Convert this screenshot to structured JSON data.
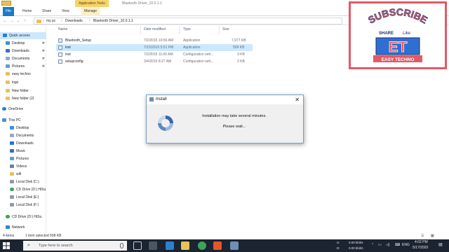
{
  "window": {
    "title": "Bluetooth Driver_10.0.1.1",
    "contextual_tab": "Application Tools"
  },
  "ribbon": {
    "tabs": [
      {
        "label": "File"
      },
      {
        "label": "Home"
      },
      {
        "label": "Share"
      },
      {
        "label": "View"
      },
      {
        "label": "Manage"
      }
    ]
  },
  "address": {
    "crumbs": [
      "my pc",
      "Downloads",
      "Bluetooth Driver_10.0.1.1"
    ]
  },
  "nav": {
    "quick_access": "Quick access",
    "pinned": [
      "Desktop",
      "Downloads",
      "Documents",
      "Pictures"
    ],
    "folders": [
      "easy techno",
      "logo",
      "New folder",
      "New folder (2)"
    ],
    "onedrive": "OneDrive",
    "this_pc": "This PC",
    "pc_items": [
      "Desktop",
      "Documents",
      "Downloads",
      "Music",
      "Pictures",
      "Videos",
      "wifi",
      "Local Disk (C:)",
      "CD Drive (D:) HiSu",
      "Local Disk (E:)",
      "Local Disk (F:)"
    ],
    "cd_drive": "CD Drive (D:) HiSu",
    "network": "Network"
  },
  "columns": {
    "name": "Name",
    "date": "Date modified",
    "type": "Type",
    "size": "Size"
  },
  "files": [
    {
      "name": "Bluetooth_Setup",
      "date": "7/2/2015 10:56 AM",
      "type": "Application",
      "size": "7,977 KB"
    },
    {
      "name": "inst",
      "date": "7/15/2015 5:51 PM",
      "type": "Application",
      "size": "509 KB"
    },
    {
      "name": "inst",
      "date": "7/2/2015 11:00 AM",
      "type": "Configuration sett...",
      "size": "3 KB"
    },
    {
      "name": "setupconfig",
      "date": "3/4/2015 8:27 AM",
      "type": "Configuration sett...",
      "size": "2 KB"
    }
  ],
  "status": {
    "items": "4 items",
    "selection": "1 item selected  508 KB"
  },
  "dialog": {
    "title": "Install",
    "message1": "Installation may take several minutes.",
    "message2": "Please wait...",
    "close": "✕"
  },
  "subscribe": {
    "word": "SUBSCRIBE",
    "share": "SHARE",
    "like": "Like",
    "logo": "ET",
    "brand": "EASY TECHNO"
  },
  "taskbar": {
    "search": "Type here to search",
    "net_up": "0.00 kbit/s",
    "net_down": "0.00 kbit/s",
    "lang": "ENG",
    "time": "4:02 PM",
    "date": "5/17/2020",
    "u": "U:",
    "d": "D:"
  },
  "colors": {
    "accent": "#1979ca",
    "tools_tab": "#f5d46b",
    "selection": "#cce8ff",
    "subscribe_red": "#e15a66",
    "logo_blue": "#2f6fd1",
    "taskbar": "#1b2430"
  }
}
